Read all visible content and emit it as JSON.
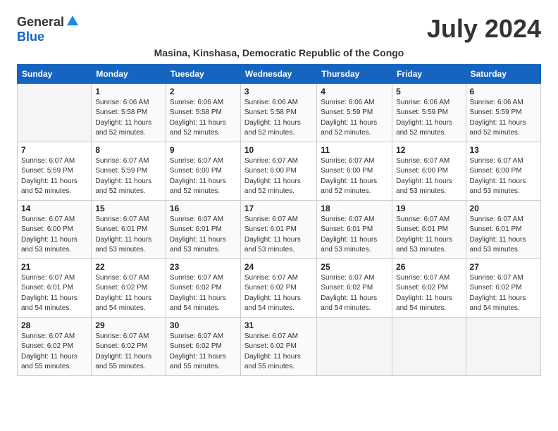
{
  "logo": {
    "general": "General",
    "blue": "Blue"
  },
  "title": "July 2024",
  "subtitle": "Masina, Kinshasa, Democratic Republic of the Congo",
  "headers": [
    "Sunday",
    "Monday",
    "Tuesday",
    "Wednesday",
    "Thursday",
    "Friday",
    "Saturday"
  ],
  "weeks": [
    [
      {
        "day": "",
        "info": ""
      },
      {
        "day": "1",
        "info": "Sunrise: 6:06 AM\nSunset: 5:58 PM\nDaylight: 11 hours and 52 minutes."
      },
      {
        "day": "2",
        "info": "Sunrise: 6:06 AM\nSunset: 5:58 PM\nDaylight: 11 hours and 52 minutes."
      },
      {
        "day": "3",
        "info": "Sunrise: 6:06 AM\nSunset: 5:58 PM\nDaylight: 11 hours and 52 minutes."
      },
      {
        "day": "4",
        "info": "Sunrise: 6:06 AM\nSunset: 5:59 PM\nDaylight: 11 hours and 52 minutes."
      },
      {
        "day": "5",
        "info": "Sunrise: 6:06 AM\nSunset: 5:59 PM\nDaylight: 11 hours and 52 minutes."
      },
      {
        "day": "6",
        "info": "Sunrise: 6:06 AM\nSunset: 5:59 PM\nDaylight: 11 hours and 52 minutes."
      }
    ],
    [
      {
        "day": "7",
        "info": "Sunrise: 6:07 AM\nSunset: 5:59 PM\nDaylight: 11 hours and 52 minutes."
      },
      {
        "day": "8",
        "info": "Sunrise: 6:07 AM\nSunset: 5:59 PM\nDaylight: 11 hours and 52 minutes."
      },
      {
        "day": "9",
        "info": "Sunrise: 6:07 AM\nSunset: 6:00 PM\nDaylight: 11 hours and 52 minutes."
      },
      {
        "day": "10",
        "info": "Sunrise: 6:07 AM\nSunset: 6:00 PM\nDaylight: 11 hours and 52 minutes."
      },
      {
        "day": "11",
        "info": "Sunrise: 6:07 AM\nSunset: 6:00 PM\nDaylight: 11 hours and 52 minutes."
      },
      {
        "day": "12",
        "info": "Sunrise: 6:07 AM\nSunset: 6:00 PM\nDaylight: 11 hours and 53 minutes."
      },
      {
        "day": "13",
        "info": "Sunrise: 6:07 AM\nSunset: 6:00 PM\nDaylight: 11 hours and 53 minutes."
      }
    ],
    [
      {
        "day": "14",
        "info": "Sunrise: 6:07 AM\nSunset: 6:00 PM\nDaylight: 11 hours and 53 minutes."
      },
      {
        "day": "15",
        "info": "Sunrise: 6:07 AM\nSunset: 6:01 PM\nDaylight: 11 hours and 53 minutes."
      },
      {
        "day": "16",
        "info": "Sunrise: 6:07 AM\nSunset: 6:01 PM\nDaylight: 11 hours and 53 minutes."
      },
      {
        "day": "17",
        "info": "Sunrise: 6:07 AM\nSunset: 6:01 PM\nDaylight: 11 hours and 53 minutes."
      },
      {
        "day": "18",
        "info": "Sunrise: 6:07 AM\nSunset: 6:01 PM\nDaylight: 11 hours and 53 minutes."
      },
      {
        "day": "19",
        "info": "Sunrise: 6:07 AM\nSunset: 6:01 PM\nDaylight: 11 hours and 53 minutes."
      },
      {
        "day": "20",
        "info": "Sunrise: 6:07 AM\nSunset: 6:01 PM\nDaylight: 11 hours and 53 minutes."
      }
    ],
    [
      {
        "day": "21",
        "info": "Sunrise: 6:07 AM\nSunset: 6:01 PM\nDaylight: 11 hours and 54 minutes."
      },
      {
        "day": "22",
        "info": "Sunrise: 6:07 AM\nSunset: 6:02 PM\nDaylight: 11 hours and 54 minutes."
      },
      {
        "day": "23",
        "info": "Sunrise: 6:07 AM\nSunset: 6:02 PM\nDaylight: 11 hours and 54 minutes."
      },
      {
        "day": "24",
        "info": "Sunrise: 6:07 AM\nSunset: 6:02 PM\nDaylight: 11 hours and 54 minutes."
      },
      {
        "day": "25",
        "info": "Sunrise: 6:07 AM\nSunset: 6:02 PM\nDaylight: 11 hours and 54 minutes."
      },
      {
        "day": "26",
        "info": "Sunrise: 6:07 AM\nSunset: 6:02 PM\nDaylight: 11 hours and 54 minutes."
      },
      {
        "day": "27",
        "info": "Sunrise: 6:07 AM\nSunset: 6:02 PM\nDaylight: 11 hours and 54 minutes."
      }
    ],
    [
      {
        "day": "28",
        "info": "Sunrise: 6:07 AM\nSunset: 6:02 PM\nDaylight: 11 hours and 55 minutes."
      },
      {
        "day": "29",
        "info": "Sunrise: 6:07 AM\nSunset: 6:02 PM\nDaylight: 11 hours and 55 minutes."
      },
      {
        "day": "30",
        "info": "Sunrise: 6:07 AM\nSunset: 6:02 PM\nDaylight: 11 hours and 55 minutes."
      },
      {
        "day": "31",
        "info": "Sunrise: 6:07 AM\nSunset: 6:02 PM\nDaylight: 11 hours and 55 minutes."
      },
      {
        "day": "",
        "info": ""
      },
      {
        "day": "",
        "info": ""
      },
      {
        "day": "",
        "info": ""
      }
    ]
  ]
}
